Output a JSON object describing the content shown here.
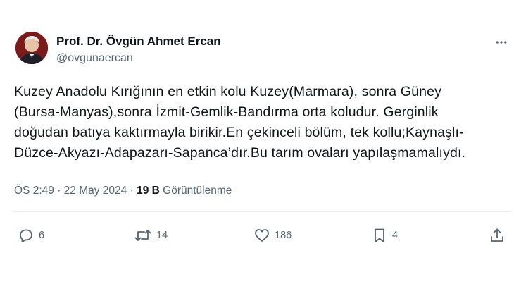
{
  "author": {
    "display_name": "Prof. Dr. Övgün Ahmet Ercan",
    "handle": "@ovgunaercan"
  },
  "tweet": {
    "text_lines": [
      "Kuzey Anadolu Kırığının en etkin kolu Kuzey(Marmara), sonra Güney",
      "(Bursa-Manyas),sonra İzmit-Gemlik-Bandırma orta koludur. Gerginlik",
      "doğudan batıya kaktırmayla birikir.En çekinceli bölüm, tek kollu;Kaynaşlı-",
      "Düzce-Akyazı-Adapazarı-Sapanca’dır.Bu tarım ovaları yapılaşmamalıydı."
    ],
    "time": "ÖS 2:49",
    "separator": "·",
    "date": "22 May 2024",
    "views_count": "19 B",
    "views_label": "Görüntülenme"
  },
  "actions": {
    "replies": "6",
    "retweets": "14",
    "likes": "186",
    "bookmarks": "4"
  },
  "icons": {
    "more": "more-horizontal-icon",
    "reply": "reply-icon",
    "retweet": "retweet-icon",
    "like": "heart-icon",
    "bookmark": "bookmark-icon",
    "share": "share-icon"
  },
  "colors": {
    "text": "#0f1419",
    "secondary": "#536471",
    "divider": "#e6ecf0"
  }
}
